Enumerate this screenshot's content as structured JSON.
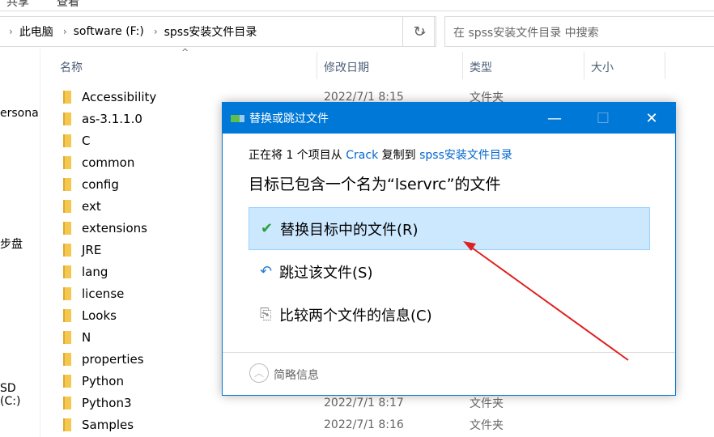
{
  "ribbon": {
    "tabs": [
      "共享",
      "查看"
    ]
  },
  "address": {
    "crumbs": [
      "此电脑",
      "software (F:)",
      "spss安装文件目录"
    ]
  },
  "search": {
    "placeholder": "在 spss安装文件目录 中搜索"
  },
  "sidebar": {
    "items": [
      "ersona",
      "步盘",
      "SD (C:)"
    ]
  },
  "columns": [
    "名称",
    "修改日期",
    "类型",
    "大小"
  ],
  "files": [
    {
      "name": "Accessibility",
      "date": "2022/7/1 8:15",
      "type": "文件夹"
    },
    {
      "name": "as-3.1.1.0"
    },
    {
      "name": "C"
    },
    {
      "name": "common"
    },
    {
      "name": "config"
    },
    {
      "name": "ext"
    },
    {
      "name": "extensions"
    },
    {
      "name": "JRE"
    },
    {
      "name": "lang"
    },
    {
      "name": "license"
    },
    {
      "name": "Looks"
    },
    {
      "name": "N"
    },
    {
      "name": "properties"
    },
    {
      "name": "Python"
    },
    {
      "name": "Python3",
      "date": "2022/7/1 8:17",
      "type": "文件夹"
    },
    {
      "name": "Samples",
      "date": "2022/7/1 8:16",
      "type": "文件夹"
    }
  ],
  "dialog": {
    "title": "替换或跳过文件",
    "copy_prefix": "正在将 1 个项目从 ",
    "source": "Crack",
    "copy_mid": " 复制到 ",
    "dest": "spss安装文件目录",
    "message": "目标已包含一个名为“lservrc”的文件",
    "options": [
      "替换目标中的文件(R)",
      "跳过该文件(S)",
      "比较两个文件的信息(C)"
    ],
    "details": "简略信息"
  },
  "colors": {
    "accent": "#0078d7",
    "annotation": "#e02020"
  }
}
